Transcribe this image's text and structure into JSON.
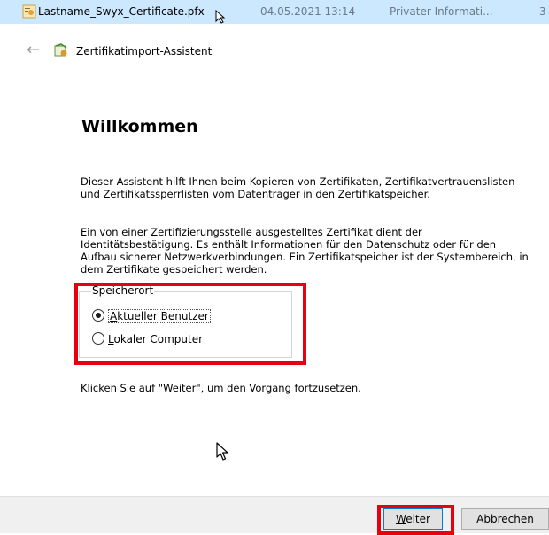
{
  "file_row": {
    "filename": "Lastname_Swyx_Certificate.pfx",
    "date": "04.05.2021 13:14",
    "type": "Privater Informati...",
    "extra": "3"
  },
  "header": {
    "title": "Zertifikatimport-Assistent"
  },
  "content": {
    "heading": "Willkommen",
    "para1": "Dieser Assistent hilft Ihnen beim Kopieren von Zertifikaten, Zertifikatvertrauenslisten und Zertifikatssperrlisten vom Datenträger in den Zertifikatspeicher.",
    "para2": "Ein von einer Zertifizierungsstelle ausgestelltes Zertifikat dient der Identitätsbestätigung. Es enthält Informationen für den Datenschutz oder für den Aufbau sicherer Netzwerkverbindungen. Ein Zertifikatspeicher ist der Systembereich, in dem Zertifikate gespeichert werden.",
    "para3": "Klicken Sie auf \"Weiter\", um den Vorgang fortzusetzen."
  },
  "storage": {
    "group_label": "Speicherort",
    "options": [
      {
        "first": "A",
        "rest": "ktueller Benutzer",
        "selected": true
      },
      {
        "first": "L",
        "rest": "okaler Computer",
        "selected": false
      }
    ]
  },
  "buttons": {
    "next_first": "W",
    "next_rest": "eiter",
    "cancel": "Abbrechen"
  },
  "colors": {
    "highlight": "#e8000f",
    "selection": "#cce8ff"
  }
}
